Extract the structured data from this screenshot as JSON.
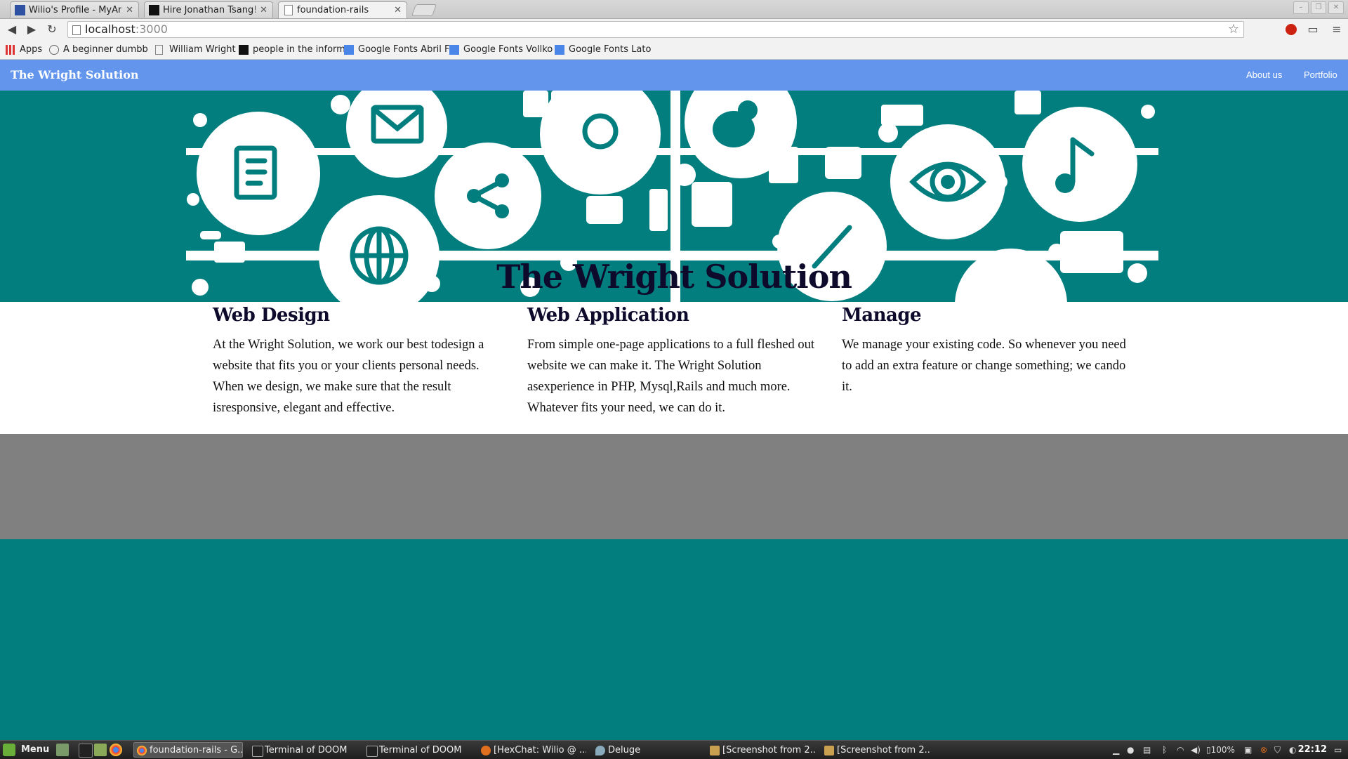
{
  "browser": {
    "tabs": [
      {
        "title": "Wilio's Profile - MyAnim",
        "active": false
      },
      {
        "title": "Hire Jonathan Tsang!",
        "active": false
      },
      {
        "title": "foundation-rails",
        "active": true
      }
    ],
    "address": {
      "host": "localhost",
      "port": ":3000"
    },
    "bookmarks": [
      {
        "label": "Apps"
      },
      {
        "label": "A beginner dumbb"
      },
      {
        "label": "William Wright"
      },
      {
        "label": "people in the inform"
      },
      {
        "label": "Google Fonts Abril F"
      },
      {
        "label": "Google Fonts Vollko"
      },
      {
        "label": "Google Fonts Lato"
      }
    ]
  },
  "site": {
    "brand": "The Wright Solution",
    "nav": [
      {
        "label": "About us"
      },
      {
        "label": "Portfolio"
      }
    ],
    "hero_title": "The Wright Solution",
    "columns": [
      {
        "heading": "Web Design",
        "body": "At the Wright Solution, we work our best todesign a website that fits you or your clients personal needs. When we design, we make sure that the result isresponsive, elegant and effective."
      },
      {
        "heading": "Web Application",
        "body": "From simple one-page applications to a full fleshed out website we can make it. The Wright Solution asexperience in PHP, Mysql,Rails and much more. Whatever fits your need, we can do it."
      },
      {
        "heading": "Manage",
        "body": "We manage your existing code. So whenever you need to add an extra feature or change something; we cando it."
      }
    ],
    "colors": {
      "nav": "#6495ed",
      "teal": "#037e7e",
      "grey": "#808080",
      "heading": "#0d0a2c"
    }
  },
  "taskbar": {
    "menu_label": "Menu",
    "tasks": [
      {
        "label": "foundation-rails - G...",
        "active": true
      },
      {
        "label": "Terminal of DOOM"
      },
      {
        "label": "Terminal of DOOM"
      },
      {
        "label": "[HexChat: Wilio @ ..."
      },
      {
        "label": "Deluge"
      },
      {
        "label": "[Screenshot from 2..."
      },
      {
        "label": "[Screenshot from 2..."
      }
    ],
    "battery": "100%",
    "clock": "22:12"
  }
}
